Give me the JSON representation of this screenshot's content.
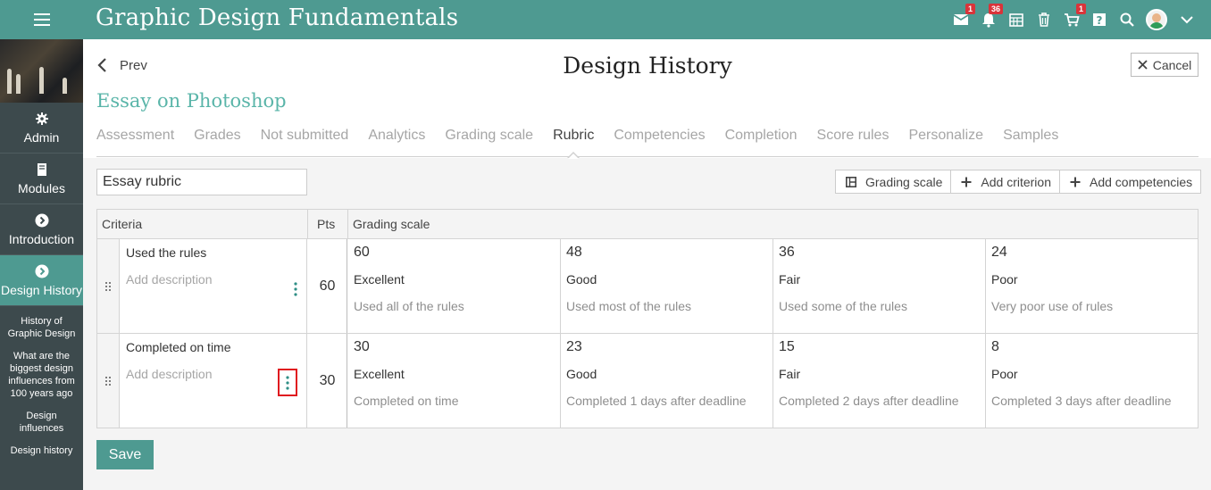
{
  "header": {
    "title": "Graphic Design Fundamentals",
    "badges": {
      "messages": "1",
      "notifications": "36",
      "cart": "1"
    },
    "icons": [
      "menu-icon",
      "envelope-icon",
      "bell-icon",
      "calendar-icon",
      "trash-icon",
      "cart-icon",
      "help-icon",
      "search-icon",
      "avatar",
      "chevron-down-icon"
    ],
    "accent_color": "#4e9a91"
  },
  "sidebar": {
    "items": [
      {
        "label": "Admin",
        "icon": "gear-icon"
      },
      {
        "label": "Modules",
        "icon": "book-icon"
      },
      {
        "label": "Introduction",
        "icon": "chevron-circle-icon"
      },
      {
        "label": "Design History",
        "icon": "chevron-circle-icon",
        "active": true
      }
    ],
    "subitems": [
      "History of Graphic Design",
      "What are the biggest design influences from 100 years ago",
      "Design influences",
      "Design history"
    ]
  },
  "page": {
    "prev_label": "Prev",
    "title": "Design History",
    "cancel_label": "Cancel",
    "subtitle": "Essay on Photoshop"
  },
  "tabs": [
    {
      "label": "Assessment"
    },
    {
      "label": "Grades"
    },
    {
      "label": "Not submitted"
    },
    {
      "label": "Analytics"
    },
    {
      "label": "Grading scale"
    },
    {
      "label": "Rubric",
      "active": true
    },
    {
      "label": "Competencies"
    },
    {
      "label": "Completion"
    },
    {
      "label": "Score rules"
    },
    {
      "label": "Personalize"
    },
    {
      "label": "Samples"
    }
  ],
  "rubric": {
    "name_value": "Essay rubric",
    "buttons": {
      "grading_scale": "Grading scale",
      "add_criterion": "Add criterion",
      "add_competencies": "Add competencies"
    },
    "headers": {
      "criteria": "Criteria",
      "pts": "Pts",
      "grading_scale": "Grading scale"
    },
    "rows": [
      {
        "name": "Used the rules",
        "description_placeholder": "Add description",
        "pts": "60",
        "levels": [
          {
            "value": "60",
            "label": "Excellent",
            "description": "Used all of the rules"
          },
          {
            "value": "48",
            "label": "Good",
            "description": "Used most of the rules"
          },
          {
            "value": "36",
            "label": "Fair",
            "description": "Used some of the rules"
          },
          {
            "value": "24",
            "label": "Poor",
            "description": "Very poor use of rules"
          }
        ]
      },
      {
        "name": "Completed on time",
        "description_placeholder": "Add description",
        "pts": "30",
        "levels": [
          {
            "value": "30",
            "label": "Excellent",
            "description": "Completed on time"
          },
          {
            "value": "23",
            "label": "Good",
            "description": "Completed 1 days after deadline"
          },
          {
            "value": "15",
            "label": "Fair",
            "description": "Completed 2 days after deadline"
          },
          {
            "value": "8",
            "label": "Poor",
            "description": "Completed 3 days after deadline"
          }
        ]
      }
    ]
  },
  "save_label": "Save"
}
